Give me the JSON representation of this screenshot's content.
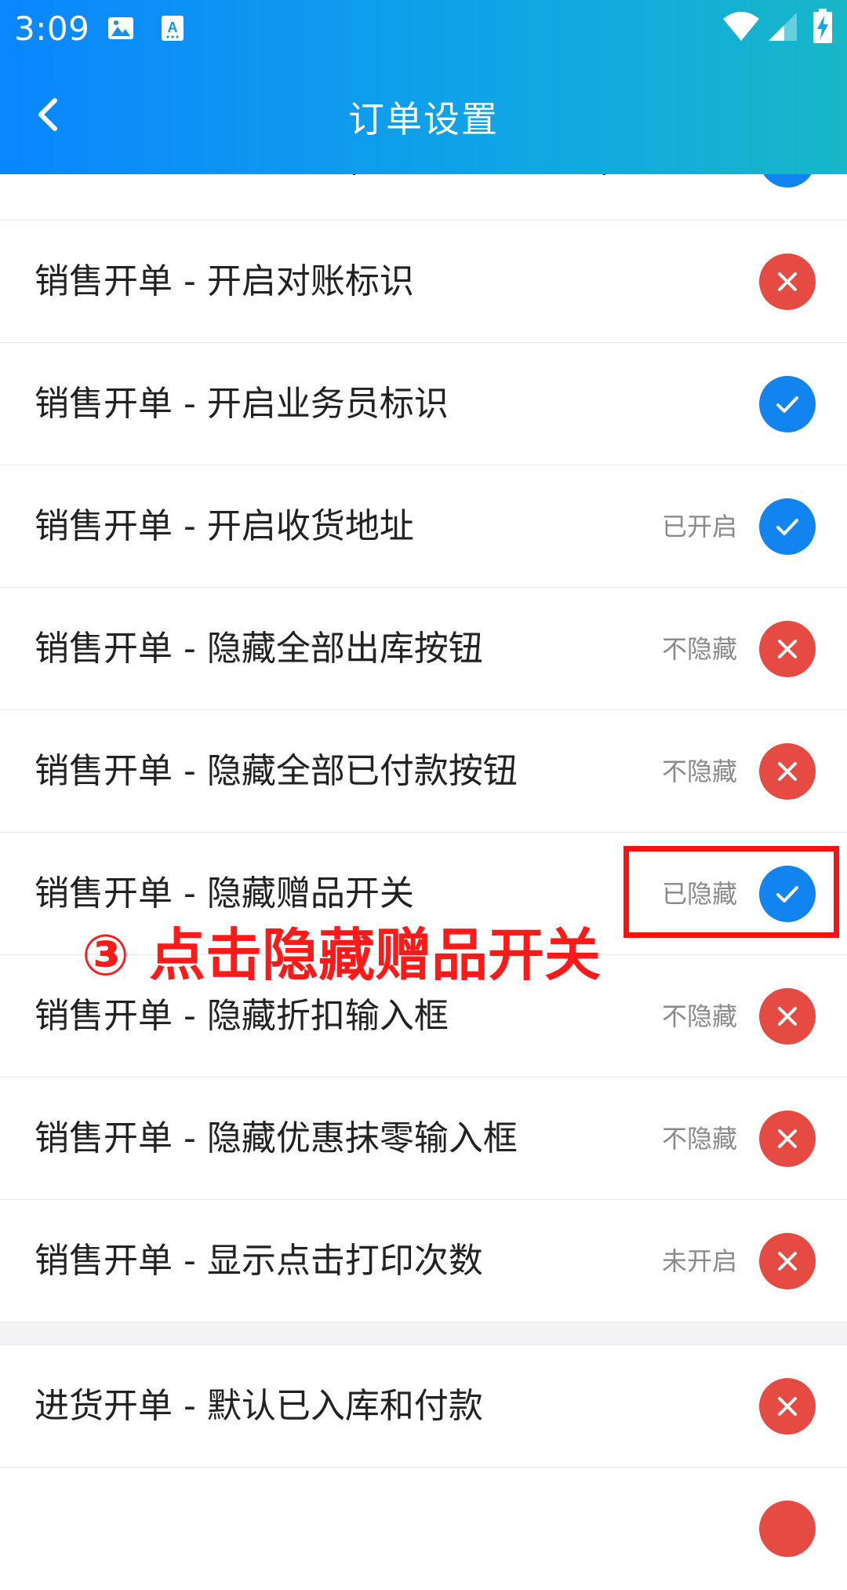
{
  "status_bar": {
    "time": "3:09",
    "icons": [
      "image-icon",
      "accessibility-app-icon",
      "wifi-icon",
      "cell-signal-icon",
      "battery-charging-icon"
    ]
  },
  "toolbar": {
    "title": "订单设置",
    "back_icon": "chevron-left-icon"
  },
  "colors": {
    "header_gradient_start": "#0a86ff",
    "header_gradient_end": "#17b7c8",
    "toggle_on": "#1184f0",
    "toggle_off": "#e54b43",
    "annotation": "#ff1010"
  },
  "list": {
    "partial_top_row": {
      "label": "销售开单 - 逆映升中(不现限订详情员)",
      "state": "on"
    },
    "rows": [
      {
        "label": "销售开单 - 开启对账标识",
        "status": "",
        "state": "off"
      },
      {
        "label": "销售开单 - 开启业务员标识",
        "status": "",
        "state": "on"
      },
      {
        "label": "销售开单 - 开启收货地址",
        "status": "已开启",
        "state": "on"
      },
      {
        "label": "销售开单 - 隐藏全部出库按钮",
        "status": "不隐藏",
        "state": "off"
      },
      {
        "label": "销售开单 - 隐藏全部已付款按钮",
        "status": "不隐藏",
        "state": "off"
      },
      {
        "label": "销售开单 - 隐藏赠品开关",
        "status": "已隐藏",
        "state": "on"
      },
      {
        "label": "销售开单 - 隐藏折扣输入框",
        "status": "不隐藏",
        "state": "off"
      },
      {
        "label": "销售开单 - 隐藏优惠抹零输入框",
        "status": "不隐藏",
        "state": "off"
      },
      {
        "label": "销售开单 - 显示点击打印次数",
        "status": "未开启",
        "state": "off"
      }
    ],
    "section2_rows": [
      {
        "label": "进货开单 - 默认已入库和付款",
        "status": "",
        "state": "off"
      }
    ]
  },
  "annotation": {
    "text": "③ 点击隐藏赠品开关"
  }
}
